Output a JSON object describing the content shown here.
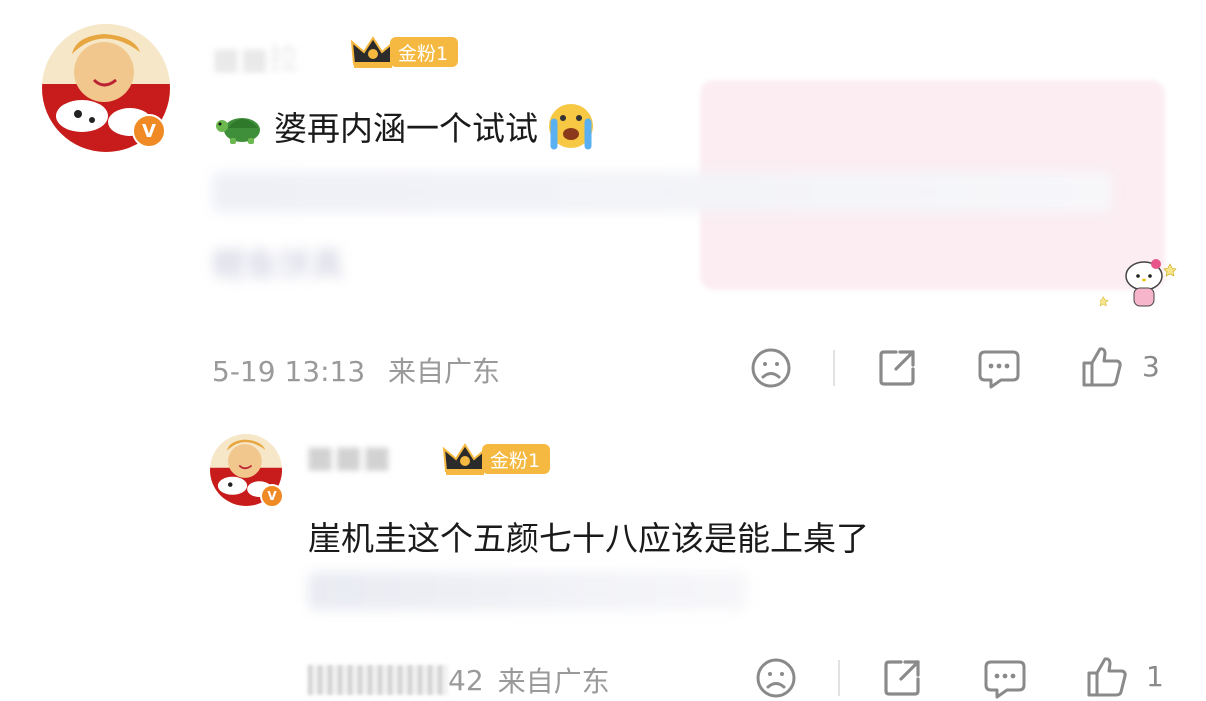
{
  "comment1": {
    "badge_label": "金粉1",
    "text": "婆再内涵一个试试",
    "partial_text_line2": "鲤鱼饼真",
    "timestamp": "5-19 13:13",
    "location": "来自广东",
    "like_count": "3"
  },
  "comment2": {
    "badge_label": "金粉1",
    "text": "崖机圭这个五颜七十八应该是能上桌了",
    "timestamp_tail": "42",
    "location": "来自广东",
    "like_count": "1"
  },
  "colors": {
    "badge": "#f5b840",
    "verified": "#f08a24",
    "meta_text": "#9a9a9a",
    "icon": "#8a8a8a"
  }
}
